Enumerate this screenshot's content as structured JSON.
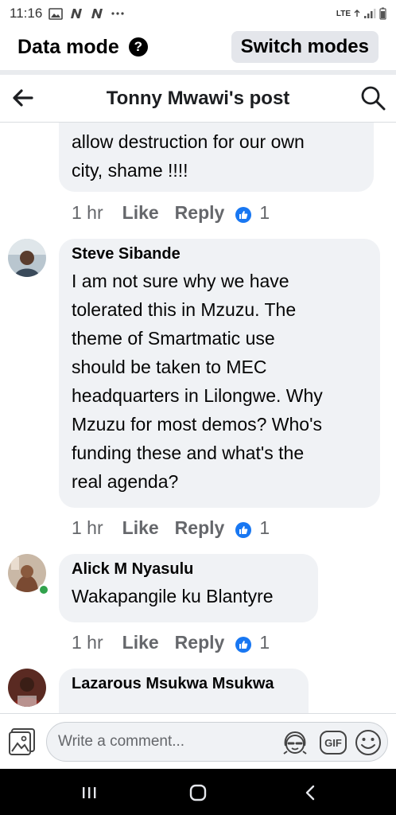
{
  "status_bar": {
    "time": "11:16",
    "icons": [
      "gallery-icon",
      "n-icon",
      "n-icon",
      "more-dots-icon"
    ],
    "network": "LTE",
    "right_icons": [
      "wifi-icon",
      "signal-icon",
      "battery-icon"
    ]
  },
  "mode_bar": {
    "title": "Data mode",
    "help": "?",
    "switch_label": "Switch modes"
  },
  "header": {
    "title": "Tonny Mwawi's post"
  },
  "comments": [
    {
      "author": "",
      "text": "allow destruction for our own\ncity, shame !!!!",
      "time": "1 hr",
      "like_label": "Like",
      "reply_label": "Reply",
      "reactions": "1"
    },
    {
      "author": "Steve Sibande",
      "text": "I am not sure why we have\ntolerated this in Mzuzu. The\ntheme of Smartmatic use\nshould be taken to MEC\nheadquarters in Lilongwe.  Why\nMzuzu for most demos? Who's\nfunding these and what's the\nreal agenda?",
      "time": "1 hr",
      "like_label": "Like",
      "reply_label": "Reply",
      "reactions": "1"
    },
    {
      "author": "Alick M Nyasulu",
      "text": "Wakapangile ku Blantyre",
      "time": "1 hr",
      "like_label": "Like",
      "reply_label": "Reply",
      "reactions": "1",
      "online": true
    },
    {
      "author": "Lazarous Msukwa Msukwa",
      "text": ""
    }
  ],
  "composer": {
    "placeholder": "Write a comment...",
    "gif_label": "GIF"
  },
  "colors": {
    "accent": "#1877f2",
    "bubble": "#f0f2f5",
    "meta": "#65676b"
  }
}
